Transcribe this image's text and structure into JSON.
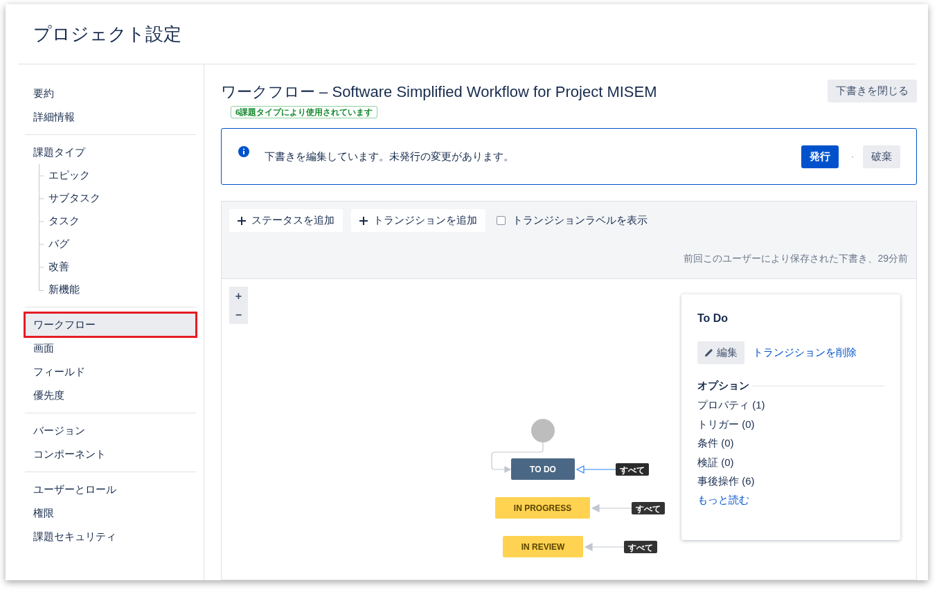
{
  "page": {
    "title": "プロジェクト設定"
  },
  "sidebar": {
    "groups": [
      {
        "items": [
          {
            "label": "要約",
            "selected": false,
            "annotated": false
          },
          {
            "label": "詳細情報",
            "selected": false,
            "annotated": false
          }
        ]
      },
      {
        "items": [
          {
            "label": "課題タイプ",
            "selected": false,
            "annotated": false,
            "children": [
              {
                "label": "エピック"
              },
              {
                "label": "サブタスク"
              },
              {
                "label": "タスク"
              },
              {
                "label": "バグ"
              },
              {
                "label": "改善"
              },
              {
                "label": "新機能"
              }
            ]
          }
        ]
      },
      {
        "items": [
          {
            "label": "ワークフロー",
            "selected": true,
            "annotated": true
          },
          {
            "label": "画面",
            "selected": false,
            "annotated": false
          },
          {
            "label": "フィールド",
            "selected": false,
            "annotated": false
          },
          {
            "label": "優先度",
            "selected": false,
            "annotated": false
          }
        ]
      },
      {
        "items": [
          {
            "label": "バージョン",
            "selected": false,
            "annotated": false
          },
          {
            "label": "コンポーネント",
            "selected": false,
            "annotated": false
          }
        ]
      },
      {
        "items": [
          {
            "label": "ユーザーとロール",
            "selected": false,
            "annotated": false
          },
          {
            "label": "権限",
            "selected": false,
            "annotated": false
          },
          {
            "label": "課題セキュリティ",
            "selected": false,
            "annotated": false
          }
        ]
      }
    ]
  },
  "workflow": {
    "title": "ワークフロー – Software Simplified Workflow for Project MISEM",
    "usage_badge": "**6課題タイプ**により使用されています",
    "close_draft_button": "下書きを閉じる"
  },
  "draft_notice": {
    "message": "下書きを編集しています。未発行の変更があります。",
    "publish_button": "発行",
    "separator": "·",
    "discard_button": "破棄"
  },
  "toolbar": {
    "add_status_button": "ステータスを追加",
    "add_transition_button": "トランジションを追加",
    "show_labels": {
      "label": "トランジションラベルを表示",
      "checked": false
    },
    "saved_note": "前回このユーザーにより保存された下書き、29分前"
  },
  "diagram": {
    "zoom_in": "+",
    "zoom_out": "−",
    "statuses": [
      {
        "name": "TO DO",
        "kind": "todo",
        "global_transition": {
          "label": "すべて",
          "selected": true
        }
      },
      {
        "name": "IN PROGRESS",
        "kind": "inprogress",
        "global_transition": {
          "label": "すべて",
          "selected": false
        }
      },
      {
        "name": "IN REVIEW",
        "kind": "inprogress",
        "global_transition": {
          "label": "すべて",
          "selected": false
        }
      }
    ]
  },
  "details_panel": {
    "title": "To Do",
    "edit_button": "編集",
    "delete_link": "トランジションを削除",
    "options_heading": "オプション",
    "options": [
      "プロパティ (1)",
      "トリガー (0)",
      "条件 (0)",
      "検証 (0)",
      "事後操作 (6)"
    ],
    "more_link": "もっと読む"
  }
}
